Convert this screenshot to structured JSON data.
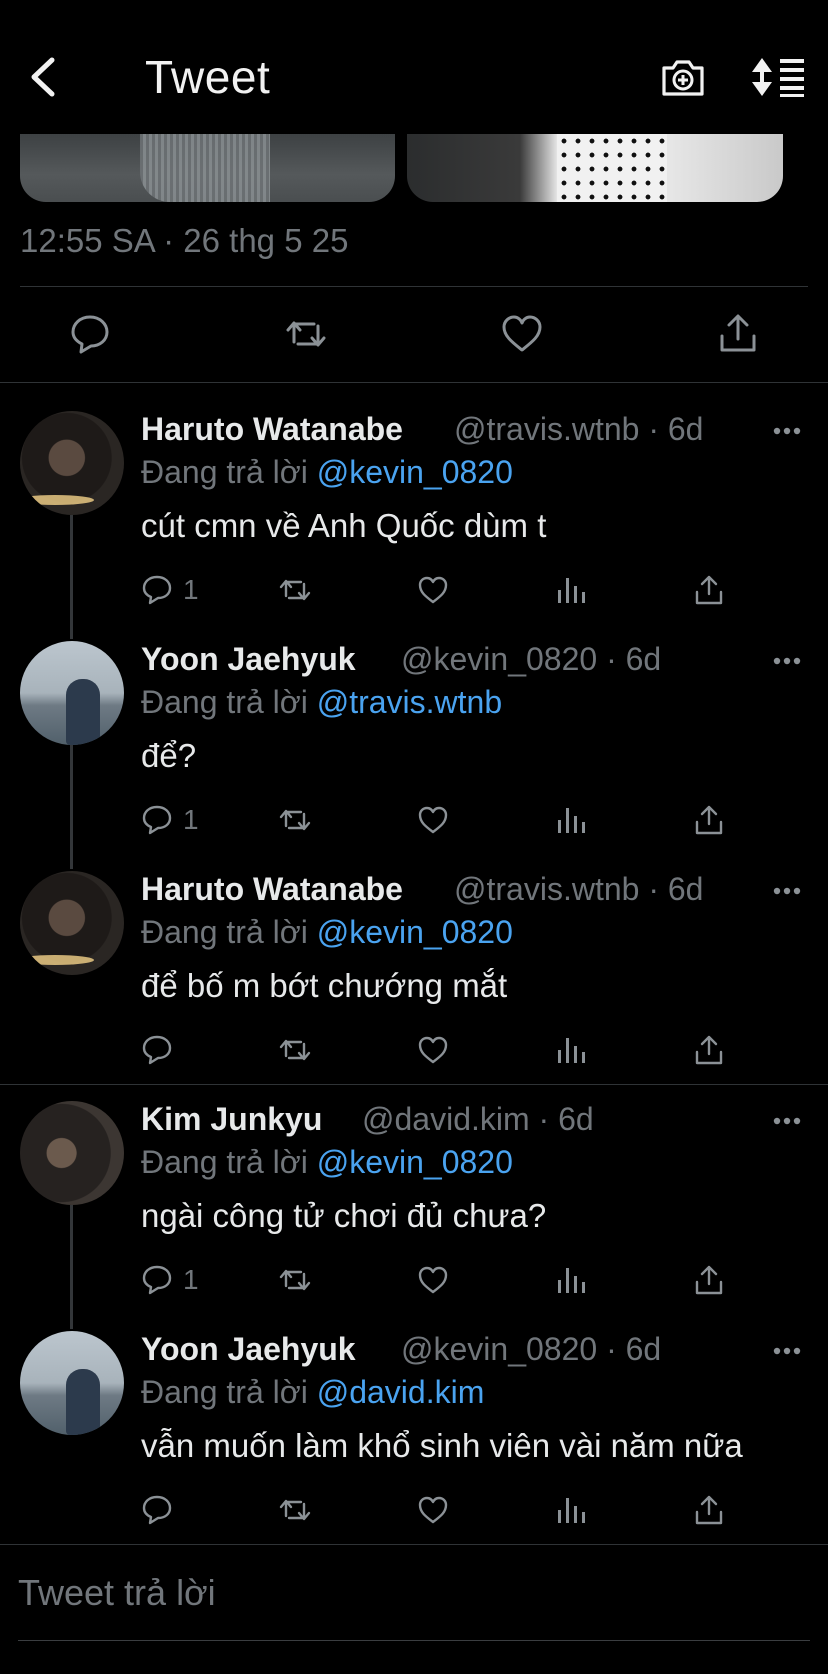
{
  "header": {
    "title": "Tweet",
    "back_icon": "chevron-left-icon",
    "camera_icon": "camera-plus-icon",
    "sort_icon": "sort-order-icon"
  },
  "tweet": {
    "timestamp": "12:55 SA · 26 thg 5 25"
  },
  "replies": [
    {
      "name": "Haruto Watanabe",
      "handle": "@travis.wtnb · 6d",
      "replying_prefix": "Đang trả lời",
      "replying_to": "@kevin_0820",
      "text": "cút cmn về Anh Quốc dùm t",
      "reply_count": "1"
    },
    {
      "name": "Yoon Jaehyuk",
      "handle": "@kevin_0820 · 6d",
      "replying_prefix": "Đang trả lời",
      "replying_to": "@travis.wtnb",
      "text": "để?",
      "reply_count": "1"
    },
    {
      "name": "Haruto Watanabe",
      "handle": "@travis.wtnb · 6d",
      "replying_prefix": "Đang trả lời",
      "replying_to": "@kevin_0820",
      "text": "để bố m bớt chướng mắt",
      "reply_count": ""
    },
    {
      "name": "Kim Junkyu",
      "handle": "@david.kim · 6d",
      "replying_prefix": "Đang trả lời",
      "replying_to": "@kevin_0820",
      "text": "ngài công tử chơi đủ chưa?",
      "reply_count": "1"
    },
    {
      "name": "Yoon Jaehyuk",
      "handle": "@kevin_0820 · 6d",
      "replying_prefix": "Đang trả lời",
      "replying_to": "@david.kim",
      "text": "vẫn muốn làm khổ sinh viên vài năm nữa",
      "reply_count": ""
    }
  ],
  "composer": {
    "placeholder": "Tweet trả lời"
  },
  "colors": {
    "background": "#000000",
    "muted": "#71767b",
    "mention": "#4aa3f0",
    "divider": "#2f3336"
  }
}
